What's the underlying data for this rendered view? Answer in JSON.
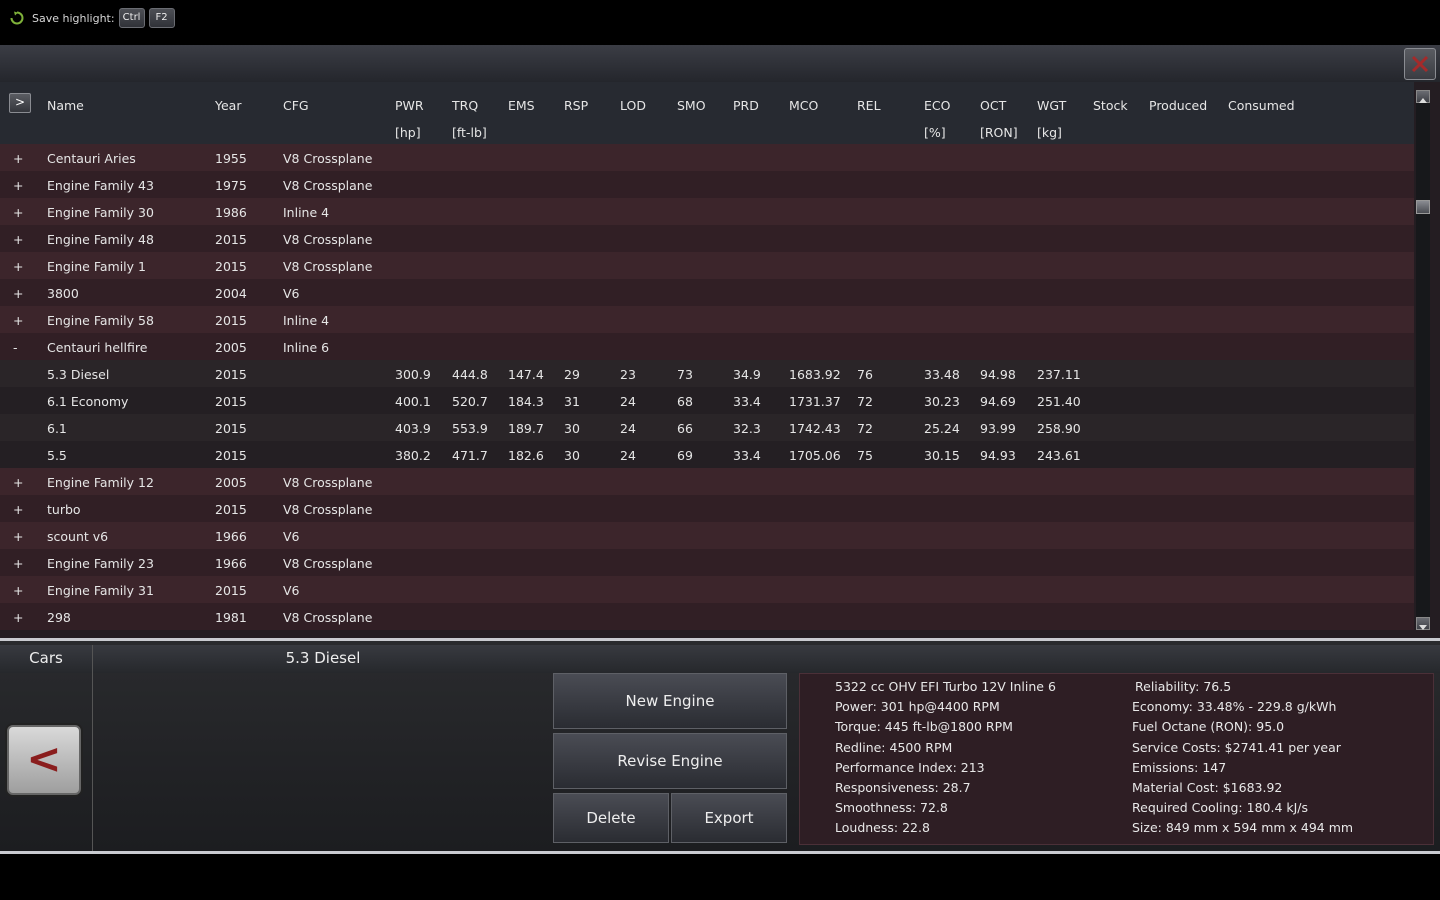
{
  "highlight": {
    "label": "Save highlight:",
    "keys": [
      "Ctrl",
      "F2"
    ]
  },
  "header": {
    "expand_label": ">",
    "columns": [
      "Name",
      "Year",
      "CFG",
      "PWR",
      "TRQ",
      "EMS",
      "RSP",
      "LOD",
      "SMO",
      "PRD",
      "MCO",
      "REL",
      "ECO",
      "OCT",
      "WGT",
      "Stock",
      "Produced",
      "Consumed"
    ],
    "units": [
      "",
      "",
      "",
      "[hp]",
      "[ft-lb]",
      "",
      "",
      "",
      "",
      "",
      "",
      "",
      "[%]",
      "[RON]",
      "[kg]",
      "",
      "",
      ""
    ]
  },
  "rows": [
    {
      "toggle": "+",
      "name": "Centauri Aries",
      "year": "1955",
      "cfg": "V8 Crossplane",
      "sub": false,
      "vals": []
    },
    {
      "toggle": "+",
      "name": "Engine Family 43",
      "year": "1975",
      "cfg": "V8 Crossplane",
      "sub": false,
      "vals": []
    },
    {
      "toggle": "+",
      "name": "Engine Family 30",
      "year": "1986",
      "cfg": "Inline 4",
      "sub": false,
      "vals": []
    },
    {
      "toggle": "+",
      "name": "Engine Family 48",
      "year": "2015",
      "cfg": "V8 Crossplane",
      "sub": false,
      "vals": []
    },
    {
      "toggle": "+",
      "name": "Engine Family 1",
      "year": "2015",
      "cfg": "V8 Crossplane",
      "sub": false,
      "vals": []
    },
    {
      "toggle": "+",
      "name": "3800",
      "year": "2004",
      "cfg": "V6",
      "sub": false,
      "vals": []
    },
    {
      "toggle": "+",
      "name": "Engine Family 58",
      "year": "2015",
      "cfg": "Inline 4",
      "sub": false,
      "vals": []
    },
    {
      "toggle": "-",
      "name": "Centauri hellfire",
      "year": "2005",
      "cfg": "Inline 6",
      "sub": false,
      "vals": []
    },
    {
      "toggle": "",
      "name": "5.3  Diesel",
      "year": "2015",
      "cfg": "",
      "sub": true,
      "vals": [
        "300.9",
        "444.8",
        "147.4",
        "29",
        "23",
        "73",
        "34.9",
        "1683.92",
        "76",
        "33.48",
        "94.98",
        "237.11"
      ]
    },
    {
      "toggle": "",
      "name": "6.1 Economy",
      "year": "2015",
      "cfg": "",
      "sub": true,
      "vals": [
        "400.1",
        "520.7",
        "184.3",
        "31",
        "24",
        "68",
        "33.4",
        "1731.37",
        "72",
        "30.23",
        "94.69",
        "251.40"
      ]
    },
    {
      "toggle": "",
      "name": "6.1",
      "year": "2015",
      "cfg": "",
      "sub": true,
      "vals": [
        "403.9",
        "553.9",
        "189.7",
        "30",
        "24",
        "66",
        "32.3",
        "1742.43",
        "72",
        "25.24",
        "93.99",
        "258.90"
      ]
    },
    {
      "toggle": "",
      "name": "5.5",
      "year": "2015",
      "cfg": "",
      "sub": true,
      "vals": [
        "380.2",
        "471.7",
        "182.6",
        "30",
        "24",
        "69",
        "33.4",
        "1705.06",
        "75",
        "30.15",
        "94.93",
        "243.61"
      ]
    },
    {
      "toggle": "+",
      "name": "Engine Family 12",
      "year": "2005",
      "cfg": "V8 Crossplane",
      "sub": false,
      "vals": []
    },
    {
      "toggle": "+",
      "name": "turbo",
      "year": "2015",
      "cfg": "V8 Crossplane",
      "sub": false,
      "vals": []
    },
    {
      "toggle": "+",
      "name": "scount v6",
      "year": "1966",
      "cfg": "V6",
      "sub": false,
      "vals": []
    },
    {
      "toggle": "+",
      "name": "Engine Family 23",
      "year": "1966",
      "cfg": "V8 Crossplane",
      "sub": false,
      "vals": []
    },
    {
      "toggle": "+",
      "name": "Engine Family 31",
      "year": "2015",
      "cfg": "V6",
      "sub": false,
      "vals": []
    },
    {
      "toggle": "+",
      "name": "298",
      "year": "1981",
      "cfg": "V8 Crossplane",
      "sub": false,
      "vals": []
    }
  ],
  "bottom": {
    "tab_cars": "Cars",
    "selected_name": "5.3 Diesel",
    "back_label": "<",
    "buttons": {
      "new_engine": "New Engine",
      "revise_engine": "Revise Engine",
      "delete": "Delete",
      "export": "Export"
    },
    "info_left": [
      "5322 cc OHV EFI Turbo 12V Inline 6",
      "Power: 301 hp@4400 RPM",
      "Torque: 445 ft-lb@1800 RPM",
      "Redline: 4500 RPM",
      "Performance Index: 213",
      "Responsiveness: 28.7",
      "Smoothness: 72.8",
      "Loudness: 22.8"
    ],
    "info_right": [
      "Reliability: 76.5",
      "Economy: 33.48% - 229.8 g/kWh",
      "Fuel Octane (RON): 95.0",
      "Service Costs: $2741.41 per year",
      "Emissions: 147",
      "Material Cost: $1683.92",
      "Required Cooling: 180.4 kJ/s",
      "Size: 849 mm x 594 mm x 494 mm"
    ]
  },
  "colors": {
    "row_dark": "#311f25",
    "row_light": "#3c252b",
    "accent_red": "#8a1d1d"
  },
  "icons": {
    "spinner": "refresh-icon",
    "close": "close-icon",
    "scroll_up": "chevron-up-icon",
    "scroll_down": "chevron-down-icon"
  }
}
